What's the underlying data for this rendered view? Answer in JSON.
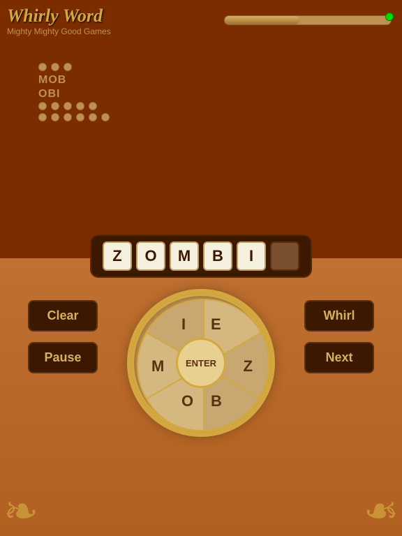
{
  "app": {
    "title": "Whirly Word",
    "subtitle": "Mighty Mighty Good Games"
  },
  "progress": {
    "fill_percent": 45,
    "dot_color": "#00DD00"
  },
  "word_lists": {
    "three_letter_dots": 3,
    "three_letter_found": [
      "MOB",
      "OBI"
    ],
    "five_letter_dots": 5,
    "six_letter_dots": 6
  },
  "current_word": {
    "letters": [
      "Z",
      "O",
      "M",
      "B",
      "I",
      ""
    ],
    "display": "ZOMBI"
  },
  "wheel": {
    "segments": [
      {
        "letter": "I",
        "position": "top-left"
      },
      {
        "letter": "E",
        "position": "top-right"
      },
      {
        "letter": "Z",
        "position": "right"
      },
      {
        "letter": "B",
        "position": "bottom-right"
      },
      {
        "letter": "O",
        "position": "bottom-left"
      },
      {
        "letter": "M",
        "position": "left"
      }
    ],
    "center_label": "ENTER"
  },
  "buttons": {
    "clear": "Clear",
    "pause": "Pause",
    "whirl": "Whirl",
    "next": "Next"
  },
  "colors": {
    "top_bg": "#7B2D00",
    "bottom_bg": "#C07030",
    "button_bg": "#3D1800",
    "button_text": "#D4B060",
    "wheel_gold": "#D4A840",
    "tile_bg": "#F5F0E0"
  }
}
